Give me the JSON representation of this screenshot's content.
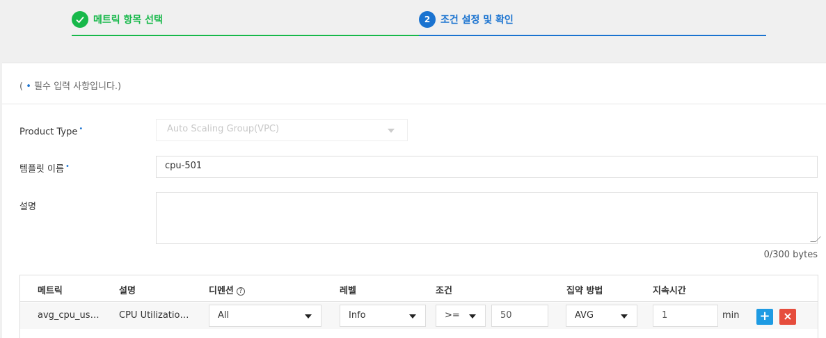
{
  "stepper": {
    "step1": {
      "label": "메트릭 항목 선택",
      "status": "completed"
    },
    "step2": {
      "number": "2",
      "label": "조건 설정 및 확인",
      "status": "active"
    }
  },
  "form": {
    "required_note": {
      "prefix": "( ",
      "dot": "•",
      "text": " 필수 입력 사항입니다.)"
    },
    "product_type": {
      "label": "Product Type",
      "value": "Auto Scaling Group(VPC)",
      "disabled": true
    },
    "template_name": {
      "label": "템플릿 이름",
      "value": "cpu-501"
    },
    "description": {
      "label": "설명",
      "value": "",
      "byte_count": "0/300 bytes"
    },
    "required_marker": "•"
  },
  "metric_table": {
    "headers": {
      "metric": "메트릭",
      "description": "설명",
      "dimension": "디멘션",
      "level": "레벨",
      "condition": "조건",
      "aggregation": "집약 방법",
      "duration": "지속시간"
    },
    "help_icon": "?",
    "row": {
      "metric": "avg_cpu_us…",
      "description": "CPU Utilizatio…",
      "dimension": "All",
      "level": "Info",
      "operator": ">=",
      "threshold": "50",
      "aggregation": "AVG",
      "duration": "1",
      "duration_unit": "min",
      "add_label": "+",
      "delete_label": "×"
    }
  },
  "colors": {
    "complete_green": "#17b84a",
    "active_blue": "#1a73d0",
    "add_button": "#1e9be3",
    "delete_button": "#e64d3d"
  }
}
